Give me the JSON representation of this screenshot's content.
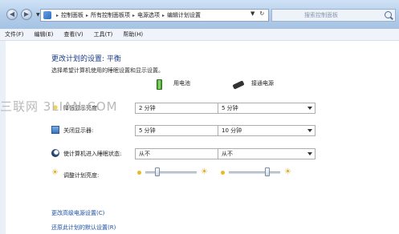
{
  "address": {
    "crumbs": [
      "控制面板",
      "所有控制面板项",
      "电源选项",
      "编辑计划设置"
    ],
    "search_placeholder": "搜索控制面板"
  },
  "menu": [
    "文件(F)",
    "编辑(E)",
    "查看(V)",
    "工具(T)",
    "帮助(H)"
  ],
  "page": {
    "title": "更改计划的设置: 平衡",
    "subtitle": "选择希望计算机使用的睡眠设置和显示设置。"
  },
  "columns": {
    "battery": "用电池",
    "plugged": "接通电源"
  },
  "rows": [
    {
      "label": "降低显示亮度:",
      "battery": "2 分钟",
      "plugged": "5 分钟"
    },
    {
      "label": "关闭显示器:",
      "battery": "5 分钟",
      "plugged": "10 分钟"
    },
    {
      "label": "使计算机进入睡眠状态:",
      "battery": "从不",
      "plugged": "从不"
    }
  ],
  "brightness": {
    "label": "调整计划亮度:",
    "battery_level": 0.2,
    "plugged_level": 0.78
  },
  "links": {
    "advanced": "更改高级电源设置(C)",
    "restore": "还原此计划的默认设置(R)"
  },
  "watermark": "三联网 3LIAN.COM"
}
